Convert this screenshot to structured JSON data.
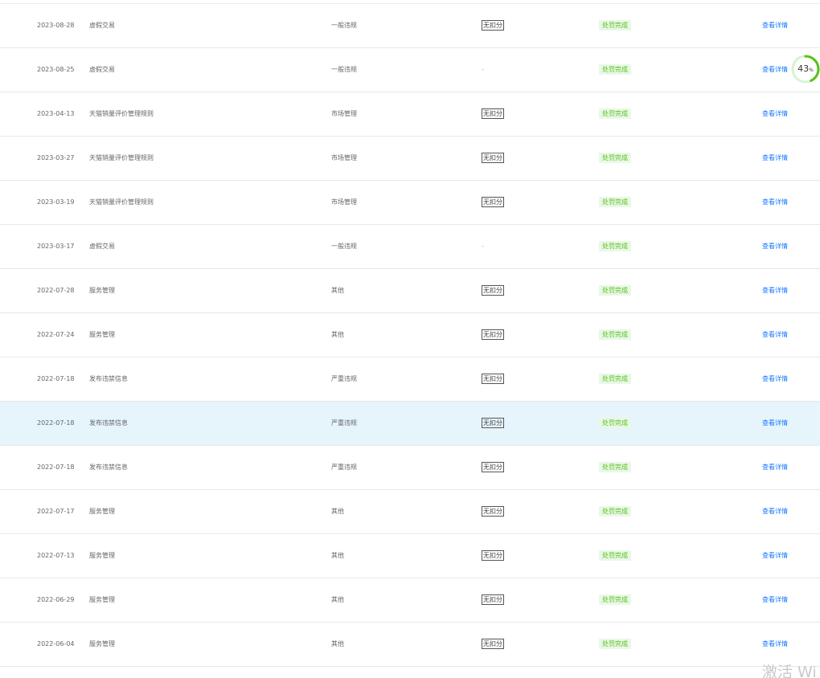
{
  "table": {
    "rows": [
      {
        "date": "2023-08-28",
        "reason": "虚假交易",
        "type": "一般违规",
        "points": "无扣分",
        "status": "处罚完成",
        "action": "查看详情"
      },
      {
        "date": "2023-08-25",
        "reason": "虚假交易",
        "type": "一般违规",
        "points": "-",
        "status": "处罚完成",
        "action": "查看详情"
      },
      {
        "date": "2023-04-13",
        "reason": "天猫销量评价管理规则",
        "type": "市场管理",
        "points": "无扣分",
        "status": "处罚完成",
        "action": "查看详情"
      },
      {
        "date": "2023-03-27",
        "reason": "天猫销量评价管理规则",
        "type": "市场管理",
        "points": "无扣分",
        "status": "处罚完成",
        "action": "查看详情"
      },
      {
        "date": "2023-03-19",
        "reason": "天猫销量评价管理规则",
        "type": "市场管理",
        "points": "无扣分",
        "status": "处罚完成",
        "action": "查看详情"
      },
      {
        "date": "2023-03-17",
        "reason": "虚假交易",
        "type": "一般违规",
        "points": "-",
        "status": "处罚完成",
        "action": "查看详情"
      },
      {
        "date": "2022-07-28",
        "reason": "服务管理",
        "type": "其他",
        "points": "无扣分",
        "status": "处罚完成",
        "action": "查看详情"
      },
      {
        "date": "2022-07-24",
        "reason": "服务管理",
        "type": "其他",
        "points": "无扣分",
        "status": "处罚完成",
        "action": "查看详情"
      },
      {
        "date": "2022-07-18",
        "reason": "发布违禁信息",
        "type": "严重违规",
        "points": "无扣分",
        "status": "处罚完成",
        "action": "查看详情"
      },
      {
        "date": "2022-07-18",
        "reason": "发布违禁信息",
        "type": "严重违规",
        "points": "无扣分",
        "status": "处罚完成",
        "action": "查看详情",
        "highlighted": true
      },
      {
        "date": "2022-07-18",
        "reason": "发布违禁信息",
        "type": "严重违规",
        "points": "无扣分",
        "status": "处罚完成",
        "action": "查看详情"
      },
      {
        "date": "2022-07-17",
        "reason": "服务管理",
        "type": "其他",
        "points": "无扣分",
        "status": "处罚完成",
        "action": "查看详情"
      },
      {
        "date": "2022-07-13",
        "reason": "服务管理",
        "type": "其他",
        "points": "无扣分",
        "status": "处罚完成",
        "action": "查看详情"
      },
      {
        "date": "2022-06-29",
        "reason": "服务管理",
        "type": "其他",
        "points": "无扣分",
        "status": "处罚完成",
        "action": "查看详情"
      },
      {
        "date": "2022-06-04",
        "reason": "服务管理",
        "type": "其他",
        "points": "无扣分",
        "status": "处罚完成",
        "action": "查看详情"
      }
    ]
  },
  "progress_widget": {
    "value": "43",
    "unit": "%",
    "fraction": 0.43,
    "ring_color": "#52c41a"
  },
  "watermark": {
    "text": "激活 Wi"
  },
  "colors": {
    "link": "#1677ff",
    "status_text": "#52c41a",
    "status_bg": "#eaf7e6",
    "highlight_row": "#e6f4fc"
  }
}
